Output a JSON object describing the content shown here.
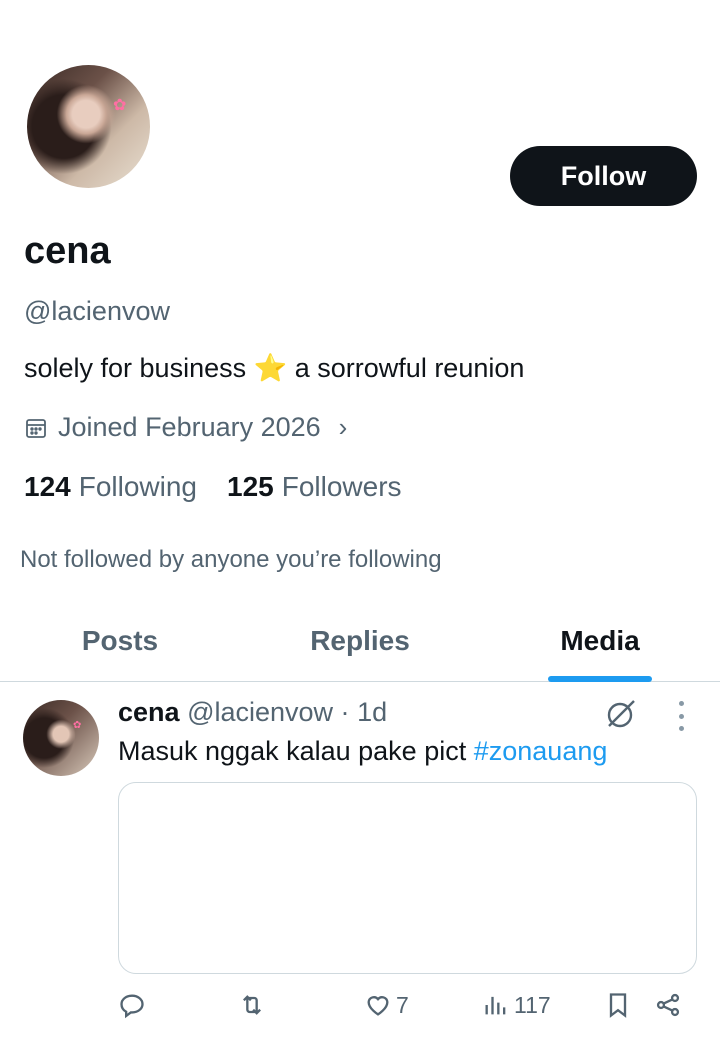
{
  "profile": {
    "display_name": "cena",
    "handle": "@lacienvow",
    "bio_before": "solely for business",
    "bio_emoji": "⭐",
    "bio_after": "a sorrowful reunion",
    "joined": "Joined February 2026",
    "following_count": "124",
    "following_label": "Following",
    "followers_count": "125",
    "followers_label": "Followers",
    "not_followed": "Not followed by anyone you’re following",
    "follow_label": "Follow"
  },
  "tabs": [
    {
      "label": "Posts"
    },
    {
      "label": "Replies"
    },
    {
      "label": "Media"
    }
  ],
  "post": {
    "name": "cena",
    "handle": "@lacienvow",
    "separator": "·",
    "time": "1d",
    "text": "Masuk nggak kalau pake pict",
    "hashtag": "#zonauang",
    "likes": "7",
    "views": "117"
  },
  "icons": {
    "calendar": "calendar-icon",
    "chevron": "chevron-right-icon",
    "reply": "reply-icon",
    "repost": "repost-icon",
    "like": "heart-icon",
    "views": "views-icon",
    "bookmark": "bookmark-icon",
    "share": "share-icon",
    "grok": "grok-icon",
    "more": "more-icon"
  },
  "colors": {
    "accent": "#1d9bf0",
    "text": "#0f1419",
    "muted": "#536471",
    "button": "#0f1419"
  }
}
